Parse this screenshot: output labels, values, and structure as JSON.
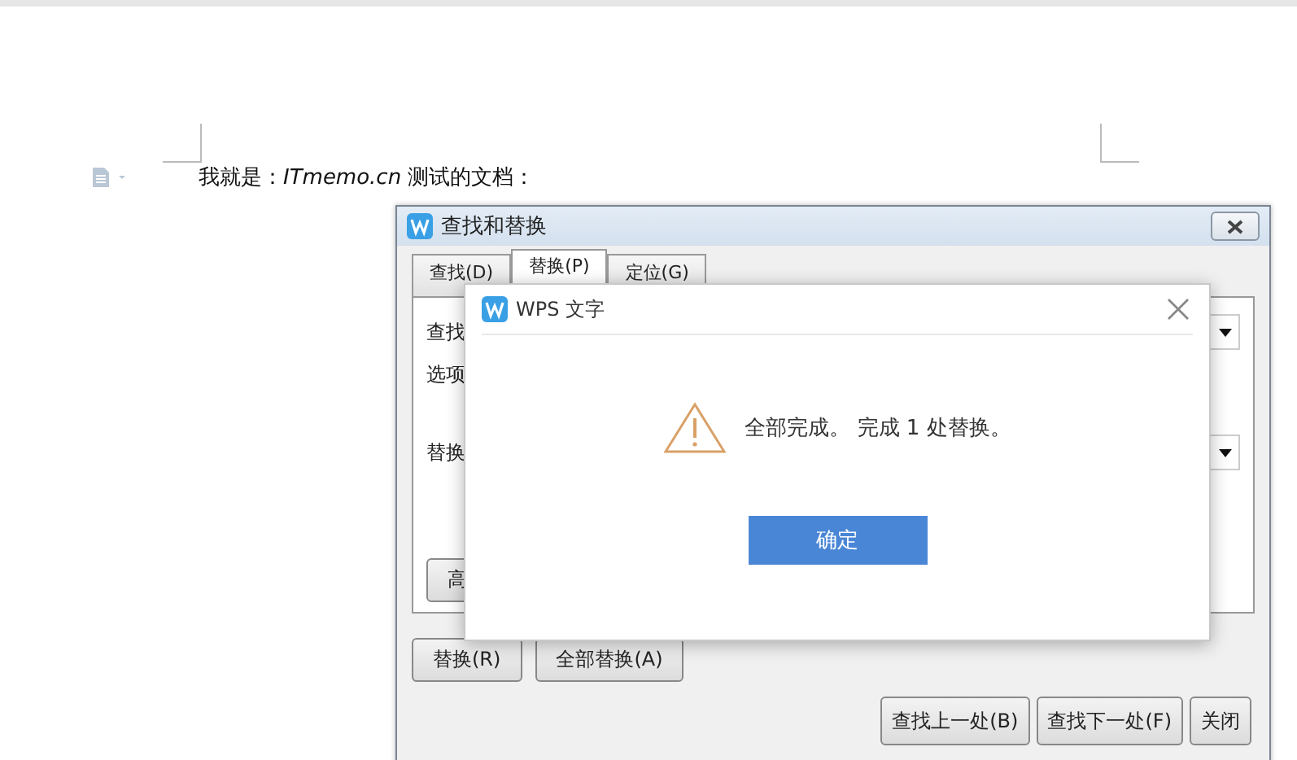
{
  "document": {
    "paragraph": "我就是：*ITmemo.cn* 测试的文档："
  },
  "find_dialog": {
    "title": "查找和替换",
    "tabs": [
      {
        "label": "查找(D)",
        "selected": false
      },
      {
        "label": "替换(P)",
        "selected": true
      },
      {
        "label": "定位(G)",
        "selected": false
      }
    ],
    "find_label": "查找",
    "options_label": "选项",
    "replace_label": "替换",
    "advanced_button": "高",
    "action_buttons": [
      "替换(R)",
      "全部替换(A)"
    ],
    "nav_buttons": [
      "查找上一处(B)",
      "查找下一处(F)",
      "关闭"
    ]
  },
  "message_box": {
    "title": "WPS 文字",
    "message": "全部完成。 完成 1 处替换。",
    "ok_button": "确定"
  }
}
